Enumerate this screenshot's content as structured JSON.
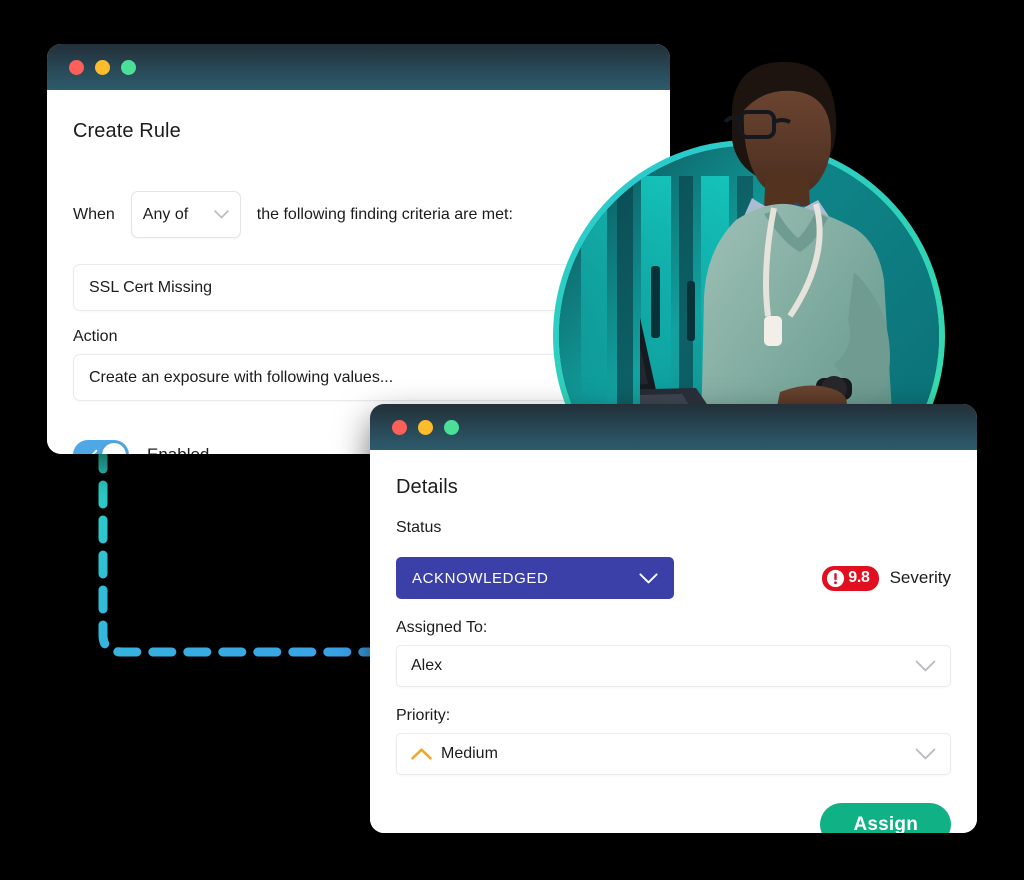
{
  "theme": {
    "background": "#000000",
    "titlebar_gradient_top": "#222f38",
    "titlebar_gradient_bottom": "#2d5b6c",
    "accent_teal": "#2fd3b6",
    "accent_blue": "#3a9fe8",
    "toggle_on": "#4ea8e6",
    "status_purple": "#3b40a8",
    "severity_red": "#e01020",
    "assign_green": "#10b285",
    "priority_orange": "#f5a623"
  },
  "connector": {
    "name": "dashed-flow-connector",
    "gradient_start": "#2ad2c0",
    "gradient_end": "#3a9fe8"
  },
  "window_create_rule": {
    "traffic_lights": [
      "close-button",
      "minimize-button",
      "maximize-button"
    ],
    "title": "Create Rule",
    "when_label": "When",
    "match_select": {
      "value": "Any of",
      "icon": "chevron-down-icon"
    },
    "when_tail": "the following finding criteria are met:",
    "criteria_value": "SSL Cert Missing",
    "action_label": "Action",
    "action_value": "Create an exposure with following values...",
    "toggle": {
      "state_label": "Enabled",
      "checked": true,
      "icon": "check-icon"
    }
  },
  "window_details": {
    "traffic_lights": [
      "close-button",
      "minimize-button",
      "maximize-button"
    ],
    "title": "Details",
    "status_label": "Status",
    "status_value": "ACKNOWLEDGED",
    "severity": {
      "score": "9.8",
      "label": "Severity",
      "icon": "alert-exclamation-icon"
    },
    "assigned_label": "Assigned To:",
    "assigned_value": "Alex",
    "priority_label": "Priority:",
    "priority_value": "Medium",
    "priority_icon": "chevron-up-icon",
    "assign_button": "Assign"
  },
  "hero": {
    "name": "person-with-laptop-photo",
    "alt": "Security analyst holding an open laptop in a data center"
  }
}
